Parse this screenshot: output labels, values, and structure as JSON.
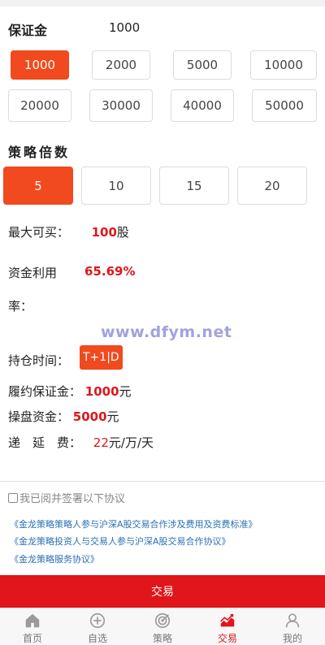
{
  "margin": {
    "label": "保证金",
    "value": "1000"
  },
  "amounts": [
    "1000",
    "2000",
    "5000",
    "10000",
    "20000",
    "30000",
    "40000",
    "50000"
  ],
  "selected_amount": "1000",
  "leverage": {
    "title": "策略倍数",
    "options": [
      "5",
      "10",
      "15",
      "20"
    ],
    "selected": "5"
  },
  "info": {
    "max_buy_label": "最大可买：",
    "max_buy_value": "100",
    "max_buy_unit": "股",
    "utilization_label_line1": "资金利用",
    "utilization_label_line2": "率：",
    "utilization_value": "65.69%",
    "hold_time_label": "持仓时间：",
    "hold_time_value": "T+1|D",
    "deposit_label": "履约保证金：",
    "deposit_value": "1000",
    "deposit_unit": "元",
    "operating_label": "操盘资金：",
    "operating_value": "5000",
    "operating_unit": "元",
    "deferral_label": "递　延　费：",
    "deferral_value": "22",
    "deferral_unit": "元/万/天"
  },
  "watermark": "www.dfym.net",
  "agreement": {
    "checkbox_label": "我已阅并签署以下协议",
    "items": [
      "《金龙策略策略人参与沪深A股交易合作涉及费用及资费标准》",
      "《金龙策略投资人与交易人参与沪深A股交易合作协议》",
      "《金龙策略服务协议》"
    ]
  },
  "trade_button": "交易",
  "tabs": [
    {
      "label": "首页",
      "icon": "home-icon"
    },
    {
      "label": "自选",
      "icon": "plus-circle-icon"
    },
    {
      "label": "策略",
      "icon": "target-icon"
    },
    {
      "label": "交易",
      "icon": "chart-trend-icon"
    },
    {
      "label": "我的",
      "icon": "user-icon"
    }
  ],
  "active_tab": "交易",
  "colors": {
    "accent": "#f04a1e",
    "red": "#e0161b",
    "link": "#2a6fb3"
  }
}
